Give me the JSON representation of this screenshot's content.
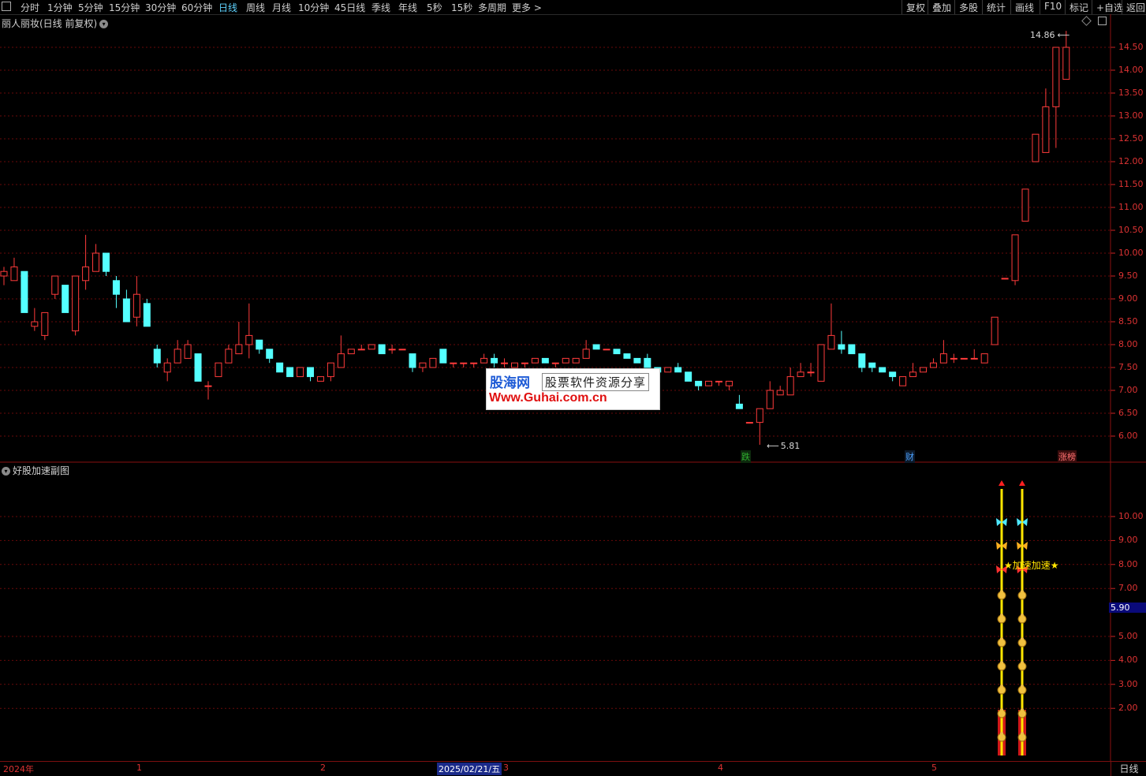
{
  "toolbar": {
    "menu_icon": "grid-icon",
    "periods": [
      "分时",
      "1分钟",
      "5分钟",
      "15分钟",
      "30分钟",
      "60分钟",
      "日线",
      "周线",
      "月线",
      "10分钟",
      "45日线",
      "季线",
      "年线",
      "5秒",
      "15秒",
      "多周期",
      "更多 >"
    ],
    "active_period": "日线",
    "right_buttons": [
      "复权",
      "叠加",
      "多股",
      "统计",
      "画线",
      "F10",
      "标记",
      "+自选",
      "返回"
    ]
  },
  "main_chart": {
    "title": "丽人丽妆(日线 前复权)",
    "title_icon": "chevron-down-icon",
    "high_marker": "14.86",
    "low_marker": "5.81",
    "price_labels": [
      "14.50",
      "14.00",
      "13.50",
      "13.00",
      "12.50",
      "12.00",
      "11.50",
      "11.00",
      "10.50",
      "10.00",
      "9.50",
      "9.00",
      "8.50",
      "8.00",
      "7.50",
      "7.00",
      "6.50",
      "6.00"
    ],
    "event_tags": [
      {
        "text": "跌",
        "color": "#2fae2f"
      },
      {
        "text": "财",
        "color": "#4aa0ff"
      },
      {
        "text": "涨榜",
        "color": "#ff5050"
      }
    ]
  },
  "sub_chart": {
    "title": "好股加速副图",
    "title_icon": "chevron-down-icon",
    "labels": [
      "10.00",
      "9.00",
      "8.00",
      "7.00",
      "5.00",
      "4.00",
      "3.00",
      "2.00"
    ],
    "current_value": "5.90",
    "signal_text": "★加速加速★"
  },
  "date_axis": {
    "ticks": [
      "2024年",
      "1",
      "2",
      "3",
      "4",
      "5"
    ],
    "highlight": "2025/02/21/五",
    "period_label": "日线"
  },
  "watermark": {
    "logo": "股海网",
    "tagline": "股票软件资源分享",
    "url": "Www.Guhai.com.cn"
  },
  "colors": {
    "up": "#ff3b3b",
    "down": "#54ffff",
    "grid": "#7a1010",
    "signal": "#ffe600"
  },
  "chart_data": {
    "type": "candlestick",
    "ylim": [
      5.6,
      14.9
    ],
    "candles": [
      [
        9.5,
        9.6,
        9.7,
        9.3
      ],
      [
        9.4,
        9.7,
        9.9,
        9.4
      ],
      [
        9.6,
        8.7,
        9.6,
        8.7
      ],
      [
        8.4,
        8.5,
        8.8,
        8.3
      ],
      [
        8.2,
        8.7,
        8.7,
        8.1
      ],
      [
        9.1,
        9.5,
        9.5,
        9.0
      ],
      [
        9.3,
        8.7,
        9.3,
        8.7
      ],
      [
        8.3,
        9.5,
        9.5,
        8.2
      ],
      [
        9.4,
        9.7,
        10.4,
        9.2
      ],
      [
        9.6,
        10.0,
        10.2,
        9.6
      ],
      [
        10.0,
        9.6,
        10.0,
        9.5
      ],
      [
        9.4,
        9.1,
        9.5,
        8.8
      ],
      [
        9.0,
        8.5,
        9.2,
        8.5
      ],
      [
        8.6,
        9.1,
        9.5,
        8.4
      ],
      [
        8.9,
        8.4,
        9.0,
        8.4
      ],
      [
        7.9,
        7.6,
        8.0,
        7.5
      ],
      [
        7.4,
        7.6,
        7.7,
        7.2
      ],
      [
        7.6,
        7.9,
        8.1,
        7.6
      ],
      [
        7.7,
        8.0,
        8.1,
        7.7
      ],
      [
        7.8,
        7.2,
        7.8,
        7.2
      ],
      [
        7.1,
        7.1,
        7.2,
        6.8
      ],
      [
        7.3,
        7.6,
        7.6,
        7.3
      ],
      [
        7.6,
        7.9,
        8.0,
        7.6
      ],
      [
        7.8,
        8.0,
        8.5,
        7.8
      ],
      [
        8.0,
        8.2,
        8.9,
        7.7
      ],
      [
        8.1,
        7.9,
        8.1,
        7.8
      ],
      [
        7.9,
        7.7,
        7.9,
        7.6
      ],
      [
        7.6,
        7.4,
        7.6,
        7.4
      ],
      [
        7.5,
        7.3,
        7.5,
        7.3
      ],
      [
        7.3,
        7.5,
        7.5,
        7.3
      ],
      [
        7.5,
        7.3,
        7.5,
        7.2
      ],
      [
        7.2,
        7.3,
        7.3,
        7.2
      ],
      [
        7.3,
        7.6,
        7.6,
        7.2
      ],
      [
        7.5,
        7.8,
        8.2,
        7.5
      ],
      [
        7.8,
        7.9,
        7.9,
        7.8
      ],
      [
        7.9,
        7.9,
        8.0,
        7.9
      ],
      [
        7.9,
        8.0,
        8.0,
        7.9
      ],
      [
        8.0,
        7.8,
        8.0,
        7.8
      ],
      [
        7.9,
        7.9,
        8.0,
        7.8
      ],
      [
        7.9,
        7.9,
        7.9,
        7.9
      ],
      [
        7.8,
        7.5,
        7.8,
        7.4
      ],
      [
        7.5,
        7.6,
        7.6,
        7.4
      ],
      [
        7.5,
        7.7,
        7.7,
        7.5
      ],
      [
        7.9,
        7.6,
        7.9,
        7.6
      ],
      [
        7.6,
        7.6,
        7.6,
        7.5
      ],
      [
        7.6,
        7.6,
        7.6,
        7.5
      ],
      [
        7.6,
        7.6,
        7.6,
        7.5
      ],
      [
        7.6,
        7.7,
        7.8,
        7.6
      ],
      [
        7.7,
        7.6,
        7.8,
        7.5
      ],
      [
        7.6,
        7.6,
        7.7,
        7.5
      ],
      [
        7.5,
        7.6,
        7.6,
        7.5
      ],
      [
        7.6,
        7.6,
        7.6,
        7.5
      ],
      [
        7.6,
        7.7,
        7.7,
        7.6
      ],
      [
        7.7,
        7.6,
        7.7,
        7.6
      ],
      [
        7.6,
        7.6,
        7.6,
        7.5
      ],
      [
        7.6,
        7.7,
        7.7,
        7.6
      ],
      [
        7.6,
        7.7,
        7.7,
        7.6
      ],
      [
        7.7,
        7.9,
        8.1,
        7.7
      ],
      [
        8.0,
        7.9,
        8.0,
        7.9
      ],
      [
        7.9,
        7.9,
        7.9,
        7.9
      ],
      [
        7.9,
        7.8,
        7.9,
        7.8
      ],
      [
        7.8,
        7.7,
        7.8,
        7.7
      ],
      [
        7.7,
        7.6,
        7.7,
        7.6
      ],
      [
        7.7,
        7.5,
        7.8,
        7.5
      ],
      [
        7.5,
        7.4,
        7.5,
        7.3
      ],
      [
        7.4,
        7.5,
        7.5,
        7.4
      ],
      [
        7.5,
        7.4,
        7.6,
        7.4
      ],
      [
        7.4,
        7.2,
        7.4,
        7.2
      ],
      [
        7.2,
        7.1,
        7.2,
        7.0
      ],
      [
        7.1,
        7.2,
        7.2,
        7.1
      ],
      [
        7.2,
        7.2,
        7.2,
        7.1
      ],
      [
        7.1,
        7.2,
        7.2,
        7.0
      ],
      [
        6.7,
        6.6,
        6.9,
        6.6
      ],
      [
        6.3,
        6.3,
        6.3,
        6.3
      ],
      [
        6.3,
        6.6,
        6.6,
        5.81
      ],
      [
        6.6,
        7.0,
        7.2,
        6.6
      ],
      [
        6.9,
        7.0,
        7.1,
        6.9
      ],
      [
        6.9,
        7.3,
        7.5,
        6.9
      ],
      [
        7.3,
        7.4,
        7.6,
        7.3
      ],
      [
        7.4,
        7.4,
        7.6,
        7.3
      ],
      [
        7.2,
        8.0,
        8.0,
        7.2
      ],
      [
        7.9,
        8.2,
        8.9,
        7.9
      ],
      [
        8.0,
        7.9,
        8.3,
        7.8
      ],
      [
        8.0,
        7.8,
        8.0,
        7.8
      ],
      [
        7.8,
        7.5,
        7.8,
        7.4
      ],
      [
        7.6,
        7.5,
        7.6,
        7.4
      ],
      [
        7.5,
        7.4,
        7.5,
        7.4
      ],
      [
        7.4,
        7.3,
        7.4,
        7.2
      ],
      [
        7.1,
        7.3,
        7.3,
        7.1
      ],
      [
        7.3,
        7.4,
        7.6,
        7.3
      ],
      [
        7.4,
        7.5,
        7.5,
        7.4
      ],
      [
        7.5,
        7.6,
        7.7,
        7.5
      ],
      [
        7.6,
        7.8,
        8.1,
        7.6
      ],
      [
        7.7,
        7.7,
        7.8,
        7.6
      ],
      [
        7.7,
        7.7,
        7.7,
        7.7
      ],
      [
        7.7,
        7.7,
        7.9,
        7.7
      ],
      [
        7.6,
        7.8,
        7.8,
        7.6
      ],
      [
        8.0,
        8.6,
        8.6,
        8.0
      ],
      [
        9.45,
        9.45,
        9.45,
        9.45
      ],
      [
        9.4,
        10.4,
        10.4,
        9.3
      ],
      [
        10.7,
        11.4,
        11.4,
        10.7
      ],
      [
        12.0,
        12.6,
        12.6,
        12.0
      ],
      [
        12.2,
        13.2,
        13.6,
        12.2
      ],
      [
        13.2,
        14.5,
        14.5,
        12.3
      ],
      [
        13.8,
        14.5,
        14.86,
        13.8
      ]
    ]
  }
}
